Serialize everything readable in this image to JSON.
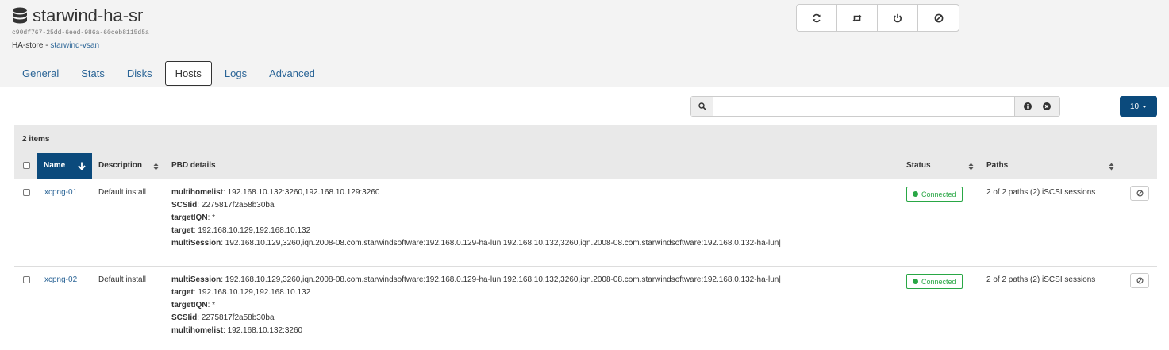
{
  "header": {
    "title": "starwind-ha-sr",
    "uuid": "c90df767-25dd-6eed-986a-60ceb8115d5a",
    "sr_type": "HA-store",
    "separator": " - ",
    "host_link": "starwind-vsan"
  },
  "actions": [
    {
      "icon": "refresh-icon"
    },
    {
      "icon": "retweet-icon"
    },
    {
      "icon": "power-icon"
    },
    {
      "icon": "ban-icon"
    }
  ],
  "tabs": [
    {
      "label": "General"
    },
    {
      "label": "Stats"
    },
    {
      "label": "Disks"
    },
    {
      "label": "Hosts"
    },
    {
      "label": "Logs"
    },
    {
      "label": "Advanced"
    }
  ],
  "active_tab": "Hosts",
  "search": {
    "value": "",
    "placeholder": ""
  },
  "page_size": "10",
  "table": {
    "items_count": "2 items",
    "columns": {
      "name": "Name",
      "description": "Description",
      "pbd": "PBD details",
      "status": "Status",
      "paths": "Paths"
    },
    "rows": [
      {
        "name": "xcpng-01",
        "description": "Default install",
        "pbd": [
          {
            "key": "multihomelist",
            "value": ": 192.168.10.132:3260,192.168.10.129:3260"
          },
          {
            "key": "SCSIid",
            "value": ": 2275817f2a58b30ba"
          },
          {
            "key": "targetIQN",
            "value": ": *"
          },
          {
            "key": "target",
            "value": ": 192.168.10.129,192.168.10.132"
          },
          {
            "key": "multiSession",
            "value": ": 192.168.10.129,3260,iqn.2008-08.com.starwindsoftware:192.168.0.129-ha-lun|192.168.10.132,3260,iqn.2008-08.com.starwindsoftware:192.168.0.132-ha-lun|"
          }
        ],
        "status": "Connected",
        "paths": "2 of 2 paths (2) iSCSI sessions"
      },
      {
        "name": "xcpng-02",
        "description": "Default install",
        "pbd": [
          {
            "key": "multiSession",
            "value": ": 192.168.10.129,3260,iqn.2008-08.com.starwindsoftware:192.168.0.129-ha-lun|192.168.10.132,3260,iqn.2008-08.com.starwindsoftware:192.168.0.132-ha-lun|"
          },
          {
            "key": "target",
            "value": ": 192.168.10.129,192.168.10.132"
          },
          {
            "key": "targetIQN",
            "value": ": *"
          },
          {
            "key": "SCSIid",
            "value": ": 2275817f2a58b30ba"
          },
          {
            "key": "multihomelist",
            "value": ": 192.168.10.132:3260"
          }
        ],
        "status": "Connected",
        "paths": "2 of 2 paths (2) iSCSI sessions"
      }
    ]
  },
  "colors": {
    "accent": "#0b4a7c",
    "link": "#2a6496",
    "success": "#29a745"
  }
}
